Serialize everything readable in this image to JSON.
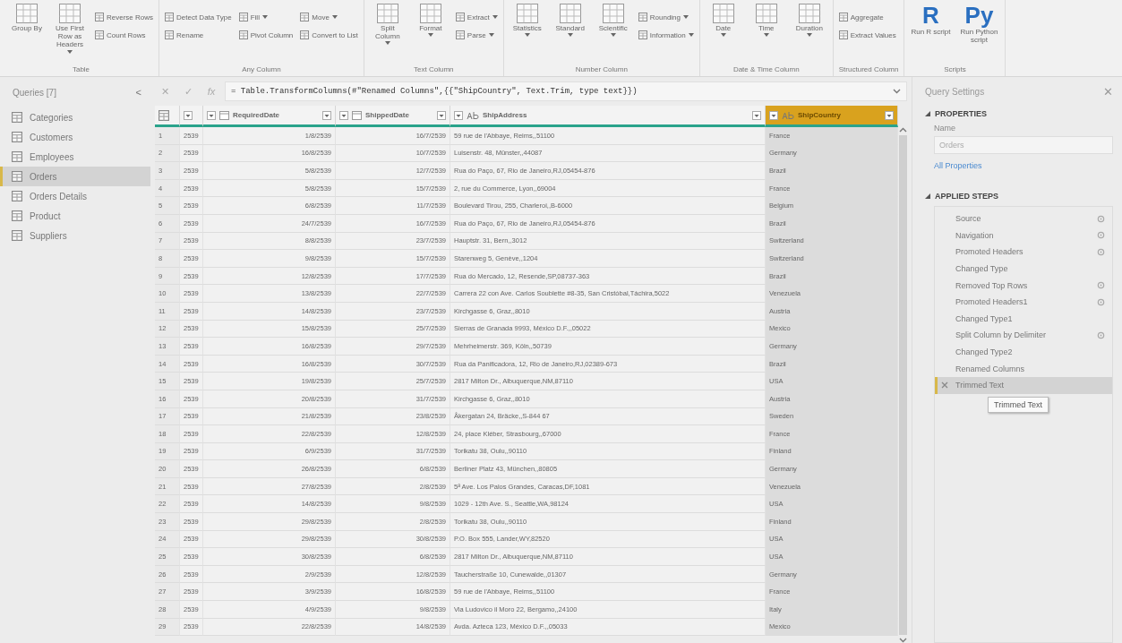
{
  "ribbon": {
    "groups": [
      {
        "label": "Table",
        "columns": [
          {
            "kind": "large",
            "label": "Group By",
            "dropdown": false
          },
          {
            "kind": "large",
            "label": "Use First Row as Headers",
            "dropdown": true
          },
          {
            "kind": "stack",
            "items": [
              {
                "label": "Reverse Rows",
                "dropdown": false
              },
              {
                "label": "Count Rows",
                "dropdown": false
              }
            ]
          }
        ]
      },
      {
        "label": "Any Column",
        "columns": [
          {
            "kind": "stack",
            "items": [
              {
                "label": "Detect Data Type",
                "dropdown": false
              },
              {
                "label": "Rename",
                "dropdown": false
              }
            ]
          },
          {
            "kind": "stack",
            "items": [
              {
                "label": "Fill",
                "dropdown": true
              },
              {
                "label": "Pivot Column",
                "dropdown": false
              }
            ]
          },
          {
            "kind": "stack",
            "items": [
              {
                "label": "Move",
                "dropdown": true
              },
              {
                "label": "Convert to List",
                "dropdown": false
              }
            ]
          }
        ]
      },
      {
        "label": "Text Column",
        "columns": [
          {
            "kind": "large",
            "label": "Split Column",
            "dropdown": true
          },
          {
            "kind": "large",
            "label": "Format",
            "dropdown": true
          },
          {
            "kind": "stack",
            "items": [
              {
                "label": "Extract",
                "dropdown": true
              },
              {
                "label": "Parse",
                "dropdown": true
              }
            ]
          }
        ]
      },
      {
        "label": "Number Column",
        "columns": [
          {
            "kind": "large",
            "label": "Statistics",
            "dropdown": true
          },
          {
            "kind": "large",
            "label": "Standard",
            "dropdown": true
          },
          {
            "kind": "large",
            "label": "Scientific",
            "dropdown": true
          },
          {
            "kind": "stack",
            "items": [
              {
                "label": "Rounding",
                "dropdown": true
              },
              {
                "label": "Information",
                "dropdown": true
              }
            ]
          }
        ]
      },
      {
        "label": "Date & Time Column",
        "columns": [
          {
            "kind": "large",
            "label": "Date",
            "dropdown": true
          },
          {
            "kind": "large",
            "label": "Time",
            "dropdown": true
          },
          {
            "kind": "large",
            "label": "Duration",
            "dropdown": true
          }
        ]
      },
      {
        "label": "Structured Column",
        "columns": [
          {
            "kind": "stack",
            "items": [
              {
                "label": "Aggregate",
                "dropdown": false
              },
              {
                "label": "Extract Values",
                "dropdown": false
              }
            ]
          }
        ]
      },
      {
        "label": "Scripts",
        "columns": [
          {
            "kind": "script",
            "glyph": "R",
            "label": "Run R script",
            "dropdown": false
          },
          {
            "kind": "script",
            "glyph": "Py",
            "label": "Run Python script",
            "dropdown": false
          }
        ]
      }
    ]
  },
  "queries": {
    "title": "Queries [7]",
    "collapse": "<",
    "items": [
      {
        "label": "Categories",
        "selected": false
      },
      {
        "label": "Customers",
        "selected": false
      },
      {
        "label": "Employees",
        "selected": false
      },
      {
        "label": "Orders",
        "selected": true
      },
      {
        "label": "Orders Details",
        "selected": false
      },
      {
        "label": "Product",
        "selected": false
      },
      {
        "label": "Suppliers",
        "selected": false
      }
    ]
  },
  "formula_bar": {
    "buttons": [
      "✕",
      "✓",
      "fx"
    ],
    "formula": "= Table.TransformColumns(#\"Renamed Columns\",{{\"ShipCountry\", Text.Trim, type text}})"
  },
  "table": {
    "columns": [
      {
        "selected": false
      },
      {
        "label": "RequiredDate",
        "kind": "date",
        "selected": false
      },
      {
        "label": "ShippedDate",
        "kind": "date",
        "selected": false
      },
      {
        "label": "ShipAddress",
        "kind": "text",
        "selected": false
      },
      {
        "label": "ShipCountry",
        "kind": "text",
        "selected": true
      }
    ],
    "rows": [
      {
        "num": "1",
        "cells": [
          "2539",
          "1/8/2539",
          "16/7/2539",
          "59 rue de l'Abbaye, Reims,,51100",
          "France"
        ]
      },
      {
        "num": "2",
        "cells": [
          "2539",
          "16/8/2539",
          "10/7/2539",
          "Luisenstr. 48, Münster,,44087",
          "Germany"
        ]
      },
      {
        "num": "3",
        "cells": [
          "2539",
          "5/8/2539",
          "12/7/2539",
          "Rua do Paço, 67, Rio de Janeiro,RJ,05454-876",
          "Brazil"
        ]
      },
      {
        "num": "4",
        "cells": [
          "2539",
          "5/8/2539",
          "15/7/2539",
          "2, rue du Commerce, Lyon,,69004",
          "France"
        ]
      },
      {
        "num": "5",
        "cells": [
          "2539",
          "6/8/2539",
          "11/7/2539",
          "Boulevard Tirou, 255, Charleroi,,B-6000",
          "Belgium"
        ]
      },
      {
        "num": "6",
        "cells": [
          "2539",
          "24/7/2539",
          "16/7/2539",
          "Rua do Paço, 67, Rio de Janeiro,RJ,05454-876",
          "Brazil"
        ]
      },
      {
        "num": "7",
        "cells": [
          "2539",
          "8/8/2539",
          "23/7/2539",
          "Hauptstr. 31, Bern,,3012",
          "Switzerland"
        ]
      },
      {
        "num": "8",
        "cells": [
          "2539",
          "9/8/2539",
          "15/7/2539",
          "Starenweg 5, Genève,,1204",
          "Switzerland"
        ]
      },
      {
        "num": "9",
        "cells": [
          "2539",
          "12/8/2539",
          "17/7/2539",
          "Rua do Mercado, 12, Resende,SP,08737-363",
          "Brazil"
        ]
      },
      {
        "num": "10",
        "cells": [
          "2539",
          "13/8/2539",
          "22/7/2539",
          "Carrera 22 con Ave. Carlos Soublette #8-35, San Cristóbal,Táchira,5022",
          "Venezuela"
        ]
      },
      {
        "num": "11",
        "cells": [
          "2539",
          "14/8/2539",
          "23/7/2539",
          "Kirchgasse 6, Graz,,8010",
          "Austria"
        ]
      },
      {
        "num": "12",
        "cells": [
          "2539",
          "15/8/2539",
          "25/7/2539",
          "Sierras de Granada 9993, México D.F.,,05022",
          "Mexico"
        ]
      },
      {
        "num": "13",
        "cells": [
          "2539",
          "16/8/2539",
          "29/7/2539",
          "Mehrheimerstr. 369, Köln,,50739",
          "Germany"
        ]
      },
      {
        "num": "14",
        "cells": [
          "2539",
          "16/8/2539",
          "30/7/2539",
          "Rua da Panificadora, 12, Rio de Janeiro,RJ,02389-673",
          "Brazil"
        ]
      },
      {
        "num": "15",
        "cells": [
          "2539",
          "19/8/2539",
          "25/7/2539",
          "2817 Milton Dr., Albuquerque,NM,87110",
          "USA"
        ]
      },
      {
        "num": "16",
        "cells": [
          "2539",
          "20/8/2539",
          "31/7/2539",
          "Kirchgasse 6, Graz,,8010",
          "Austria"
        ]
      },
      {
        "num": "17",
        "cells": [
          "2539",
          "21/8/2539",
          "23/8/2539",
          "Åkergatan 24, Bräcke,,S-844 67",
          "Sweden"
        ]
      },
      {
        "num": "18",
        "cells": [
          "2539",
          "22/8/2539",
          "12/8/2539",
          "24, place Kléber, Strasbourg,,67000",
          "France"
        ]
      },
      {
        "num": "19",
        "cells": [
          "2539",
          "6/9/2539",
          "31/7/2539",
          "Torikatu 38, Oulu,,90110",
          "Finland"
        ]
      },
      {
        "num": "20",
        "cells": [
          "2539",
          "26/8/2539",
          "6/8/2539",
          "Berliner Platz 43, München,,80805",
          "Germany"
        ]
      },
      {
        "num": "21",
        "cells": [
          "2539",
          "27/8/2539",
          "2/8/2539",
          "5ª Ave. Los Palos Grandes, Caracas,DF,1081",
          "Venezuela"
        ]
      },
      {
        "num": "22",
        "cells": [
          "2539",
          "14/8/2539",
          "9/8/2539",
          "1029 - 12th Ave. S., Seattle,WA,98124",
          "USA"
        ]
      },
      {
        "num": "23",
        "cells": [
          "2539",
          "29/8/2539",
          "2/8/2539",
          "Torikatu 38, Oulu,,90110",
          "Finland"
        ]
      },
      {
        "num": "24",
        "cells": [
          "2539",
          "29/8/2539",
          "30/8/2539",
          "P.O. Box 555, Lander,WY,82520",
          "USA"
        ]
      },
      {
        "num": "25",
        "cells": [
          "2539",
          "30/8/2539",
          "6/8/2539",
          "2817 Milton Dr., Albuquerque,NM,87110",
          "USA"
        ]
      },
      {
        "num": "26",
        "cells": [
          "2539",
          "2/9/2539",
          "12/8/2539",
          "Taucherstraße 10, Cunewalde,,01307",
          "Germany"
        ]
      },
      {
        "num": "27",
        "cells": [
          "2539",
          "3/9/2539",
          "16/8/2539",
          "59 rue de l'Abbaye, Reims,,51100",
          "France"
        ]
      },
      {
        "num": "28",
        "cells": [
          "2539",
          "4/9/2539",
          "9/8/2539",
          "Via Ludovico il Moro 22, Bergamo,,24100",
          "Italy"
        ]
      },
      {
        "num": "29",
        "cells": [
          "2539",
          "22/8/2539",
          "14/8/2539",
          "Avda. Azteca 123, México D.F.,,05033",
          "Mexico"
        ]
      }
    ]
  },
  "query_settings": {
    "title": "Query Settings",
    "close": "✕",
    "properties_heading": "PROPERTIES",
    "name_label": "Name",
    "name_value": "Orders",
    "all_properties_link": "All Properties",
    "steps_heading": "APPLIED STEPS",
    "steps": [
      {
        "label": "Source",
        "settings": true,
        "selected": false
      },
      {
        "label": "Navigation",
        "settings": true,
        "selected": false
      },
      {
        "label": "Promoted Headers",
        "settings": true,
        "selected": false
      },
      {
        "label": "Changed Type",
        "settings": false,
        "selected": false
      },
      {
        "label": "Removed Top Rows",
        "settings": true,
        "selected": false
      },
      {
        "label": "Promoted Headers1",
        "settings": true,
        "selected": false
      },
      {
        "label": "Changed Type1",
        "settings": false,
        "selected": false
      },
      {
        "label": "Split Column by Delimiter",
        "settings": true,
        "selected": false
      },
      {
        "label": "Changed Type2",
        "settings": false,
        "selected": false
      },
      {
        "label": "Renamed Columns",
        "settings": false,
        "selected": false
      },
      {
        "label": "Trimmed Text",
        "settings": false,
        "selected": true
      }
    ],
    "tooltip": "Trimmed Text"
  }
}
